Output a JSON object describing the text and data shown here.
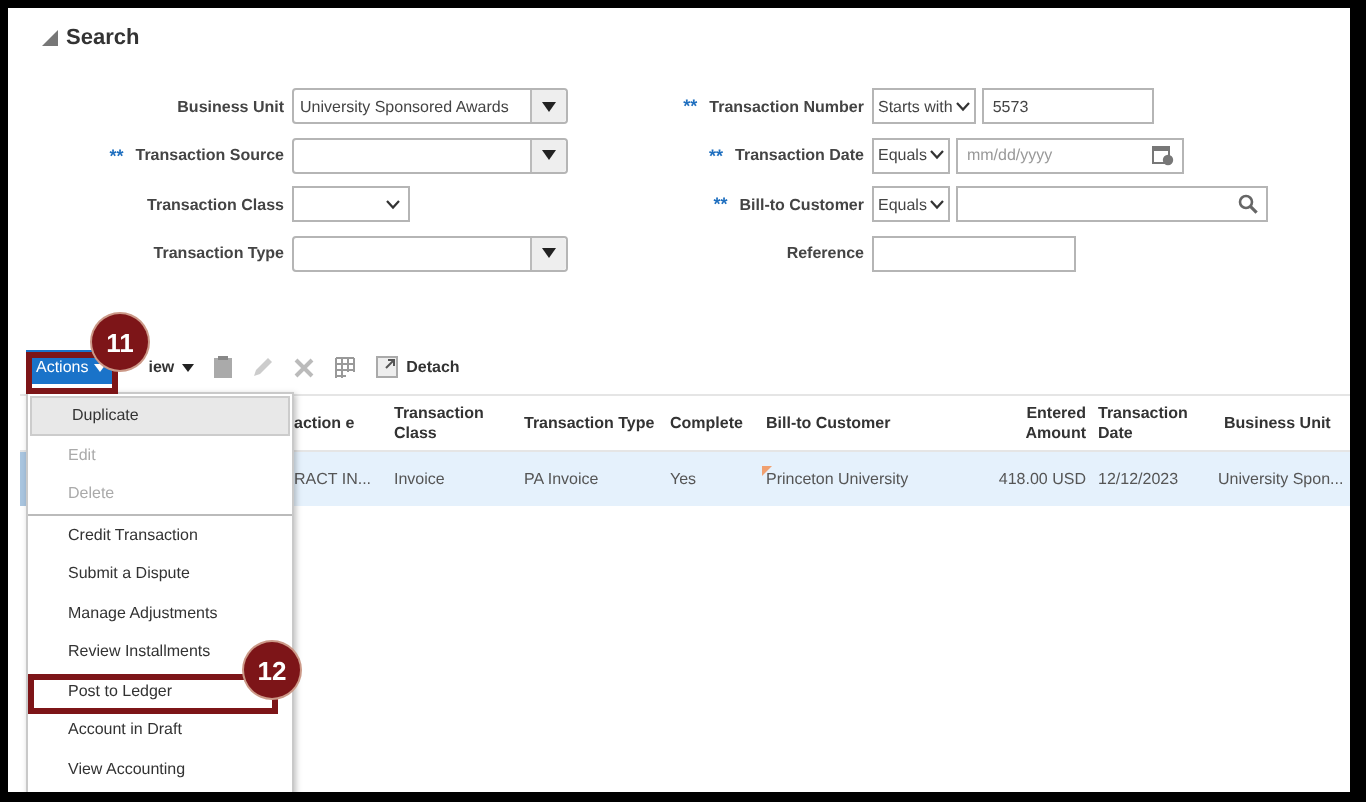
{
  "search": {
    "title": "Search",
    "expanded": true,
    "left_fields": [
      {
        "label": "Business Unit",
        "kind": "combo",
        "value": "University Sponsored Awards"
      },
      {
        "label": "Transaction Source",
        "required_mark": "**",
        "kind": "combo"
      },
      {
        "label": "Transaction Class",
        "kind": "select"
      },
      {
        "label": "Transaction Type",
        "kind": "combo"
      }
    ],
    "right_fields": [
      {
        "label": "Transaction Number",
        "required_mark": "**",
        "kind": "text",
        "operator": "Starts with",
        "value": "5573"
      },
      {
        "label": "Transaction Date",
        "required_mark": "**",
        "kind": "date",
        "operator": "Equals",
        "placeholder": "mm/dd/yyyy"
      },
      {
        "label": "Bill-to Customer",
        "required_mark": "**",
        "kind": "search",
        "operator": "Equals"
      },
      {
        "label": "Reference",
        "kind": "text"
      }
    ]
  },
  "toolbar": {
    "actions": "Actions",
    "view": "iew",
    "detach": "Detach"
  },
  "table": {
    "columns": [
      {
        "label": "action e"
      },
      {
        "label": "Transaction Class"
      },
      {
        "label": "Transaction Type"
      },
      {
        "label": "Complete"
      },
      {
        "label": "Bill-to Customer"
      },
      {
        "label": "Entered Amount"
      },
      {
        "label": "Transaction Date"
      },
      {
        "label": "Business Unit"
      }
    ],
    "rows": [
      {
        "selected": true,
        "cells": [
          "RACT IN...",
          "Invoice",
          "PA Invoice",
          "Yes",
          "Princeton University",
          "418.00 USD",
          "12/12/2023",
          "University Spon..."
        ]
      }
    ]
  },
  "actions_menu": {
    "groups": [
      {
        "items": [
          {
            "label": "Duplicate",
            "selected": true,
            "disabled": false
          },
          {
            "label": "Edit",
            "selected": false,
            "disabled": true
          },
          {
            "label": "Delete",
            "selected": false,
            "disabled": true
          }
        ]
      },
      {
        "items": [
          {
            "label": "Credit Transaction",
            "selected": false,
            "disabled": false
          },
          {
            "label": "Submit a Dispute",
            "selected": false,
            "disabled": false
          },
          {
            "label": "Manage Adjustments",
            "selected": false,
            "disabled": false
          },
          {
            "label": "Review Installments",
            "selected": false,
            "disabled": false
          },
          {
            "label": "Post to Ledger",
            "selected": false,
            "disabled": false
          },
          {
            "label": "Account in Draft",
            "selected": false,
            "disabled": false
          },
          {
            "label": "View Accounting",
            "selected": false,
            "disabled": false
          }
        ]
      }
    ]
  },
  "callouts": [
    {
      "number": "11"
    },
    {
      "number": "12"
    }
  ]
}
